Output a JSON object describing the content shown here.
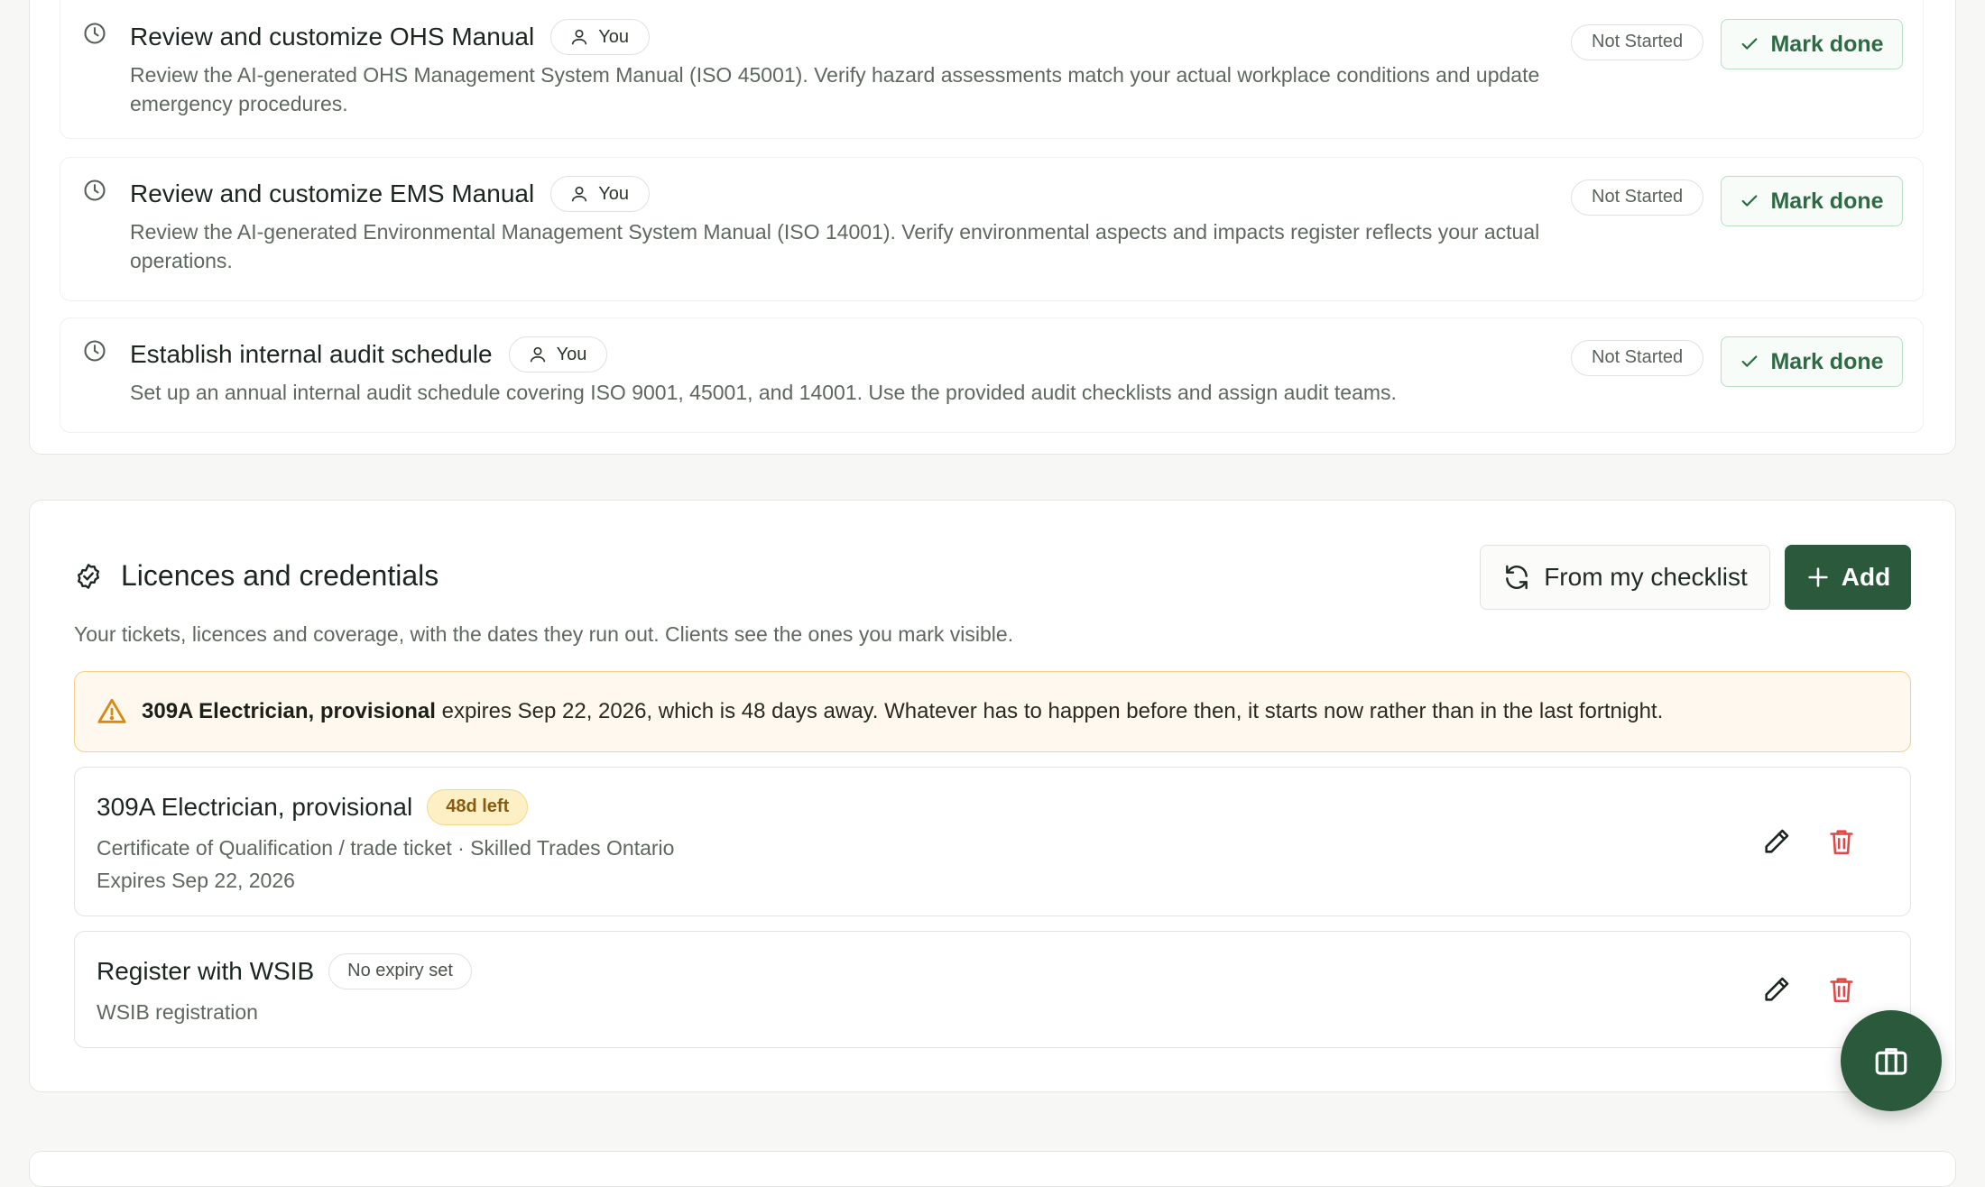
{
  "tasks": [
    {
      "title": "Review and customize OHS Manual",
      "assignee": "You",
      "description": "Review the AI-generated OHS Management System Manual (ISO 45001). Verify hazard assessments match your actual workplace conditions and update emergency procedures.",
      "status": "Not Started",
      "action": "Mark done"
    },
    {
      "title": "Review and customize EMS Manual",
      "assignee": "You",
      "description": "Review the AI-generated Environmental Management System Manual (ISO 14001). Verify environmental aspects and impacts register reflects your actual operations.",
      "status": "Not Started",
      "action": "Mark done"
    },
    {
      "title": "Establish internal audit schedule",
      "assignee": "You",
      "description": "Set up an annual internal audit schedule covering ISO 9001, 45001, and 14001. Use the provided audit checklists and assign audit teams.",
      "status": "Not Started",
      "action": "Mark done"
    }
  ],
  "licences": {
    "title": "Licences and credentials",
    "subtitle": "Your tickets, licences and coverage, with the dates they run out. Clients see the ones you mark visible.",
    "checklist_button": "From my checklist",
    "add_button": "Add",
    "alert": {
      "strong": "309A Electrician, provisional",
      "text": " expires Sep 22, 2026, which is 48 days away. Whatever has to happen before then, it starts now rather than in the last fortnight."
    },
    "items": [
      {
        "name": "309A Electrician, provisional",
        "badge": "48d left",
        "detail": "Certificate of Qualification / trade ticket · Skilled Trades Ontario",
        "expires": "Expires Sep 22, 2026"
      },
      {
        "name": "Register with WSIB",
        "badge": "No expiry set",
        "detail": "WSIB registration"
      }
    ]
  },
  "colors": {
    "brand": "#2a5a3b",
    "success_text": "#2e6a45",
    "warning_bg": "#fff8ee",
    "warning_border": "#f4cf8a",
    "danger": "#e04848"
  },
  "icons": {
    "task": "clock-icon",
    "assignee": "user-icon",
    "done": "check-icon",
    "section": "badge-check-icon",
    "sync": "refresh-icon",
    "add": "plus-icon",
    "alert": "warning-icon",
    "edit": "pencil-icon",
    "delete": "trash-icon",
    "fab": "briefcase-icon"
  }
}
